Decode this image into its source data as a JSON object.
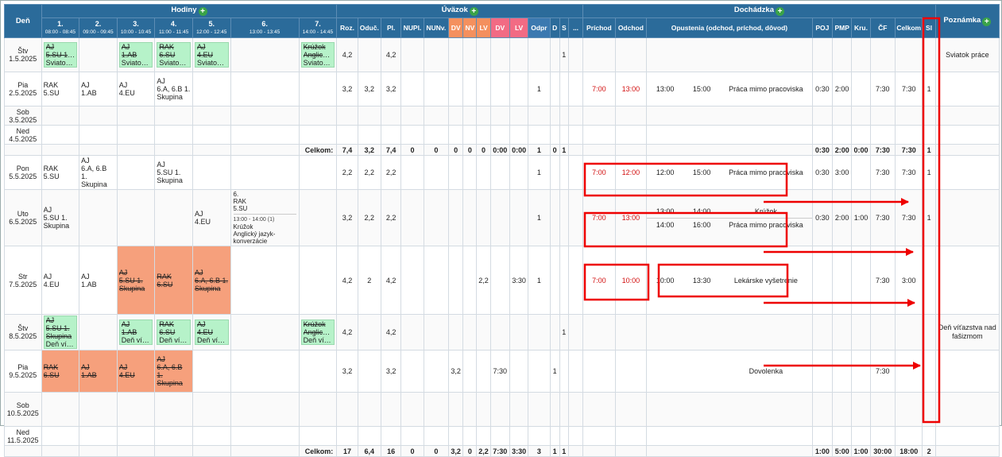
{
  "head": {
    "den": "Deň",
    "hodiny": "Hodiny",
    "uvazok": "Úväzok",
    "dochadzka": "Dochádzka",
    "poznamka": "Poznámka",
    "plus": "+",
    "periods": [
      [
        "1.",
        "08:00 - 08:45"
      ],
      [
        "2.",
        "09:00 - 09:45"
      ],
      [
        "3.",
        "10:00 - 10:45"
      ],
      [
        "4.",
        "11:00 - 11:45"
      ],
      [
        "5.",
        "12:00 - 12:45"
      ],
      [
        "6.",
        "13:00 - 13:45"
      ],
      [
        "7.",
        "14:00 - 14:45"
      ]
    ],
    "cols": [
      "Roz.",
      "Oduč.",
      "Pl.",
      "NUPl.",
      "NUNv.",
      "DV",
      "NV",
      "LV",
      "DV",
      "LV",
      "Odpr",
      "D",
      "S",
      "...",
      "Príchod",
      "Odchod",
      "Opustenia (odchod, príchod, dôvod)",
      "POJ",
      "PMP",
      "Kru.",
      "ČF",
      "Celkom",
      "Sl"
    ]
  },
  "rows": [
    {
      "day": "Štv",
      "date": "1.5.2025",
      "les": [
        "AJ|5.SU 1. Skupina|Sviatok práce",
        "",
        "AJ|1.AB|Sviatok práce",
        "RAK|6.SU|Sviatok práce",
        "AJ|4.EU|Sviatok práce",
        "",
        "Krúžok|Anglický jazyk-konverzácie|Sviatok práce"
      ],
      "v": [
        "4,2",
        "",
        "4,2",
        "",
        "",
        "",
        "",
        "",
        "",
        "",
        "",
        "",
        "1",
        ""
      ],
      "prich": "",
      "odch": "",
      "ab": [],
      "poj": "",
      "pmp": "",
      "kru": "",
      "cf": "",
      "cel": "",
      "sl": "",
      "note": "Sviatok práce"
    },
    {
      "day": "Pia",
      "date": "2.5.2025",
      "les": [
        "RAK|5.SU",
        "AJ|1.AB",
        "AJ|4.EU",
        "AJ|6.A, 6.B 1.|Skupina",
        "",
        "",
        ""
      ],
      "v": [
        "3,2",
        "3,2",
        "3,2",
        "",
        "",
        "",
        "",
        "",
        "",
        "",
        "1",
        "",
        "",
        ""
      ],
      "prich": "7:00",
      "odch": "13:00",
      "ab": [
        [
          "13:00",
          "15:00",
          "Práca mimo pracoviska"
        ]
      ],
      "poj": "0:30",
      "pmp": "2:00",
      "kru": "",
      "cf": "7:30",
      "cel": "7:30",
      "sl": "1",
      "note": ""
    },
    {
      "day": "Sob",
      "date": "3.5.2025",
      "les": [
        "",
        "",
        "",
        "",
        "",
        "",
        ""
      ],
      "v": [
        "",
        "",
        "",
        "",
        "",
        "",
        "",
        "",
        "",
        "",
        "",
        "",
        "",
        ""
      ],
      "prich": "",
      "odch": "",
      "ab": [],
      "poj": "",
      "pmp": "",
      "kru": "",
      "cf": "",
      "cel": "",
      "sl": "",
      "note": ""
    },
    {
      "day": "Ned",
      "date": "4.5.2025",
      "les": [
        "",
        "",
        "",
        "",
        "",
        "",
        ""
      ],
      "v": [
        "",
        "",
        "",
        "",
        "",
        "",
        "",
        "",
        "",
        "",
        "",
        "",
        "",
        ""
      ],
      "prich": "",
      "odch": "",
      "ab": [],
      "poj": "",
      "pmp": "",
      "kru": "",
      "cf": "",
      "cel": "",
      "sl": "",
      "note": ""
    },
    {
      "day": "Pon",
      "date": "5.5.2025",
      "les": [
        "RAK|5.SU",
        "AJ|6.A, 6.B|1.|Skupina",
        "",
        "AJ|5.SU 1.|Skupina",
        "",
        "",
        ""
      ],
      "v": [
        "2,2",
        "2,2",
        "2,2",
        "",
        "",
        "",
        "",
        "",
        "",
        "",
        "1",
        "",
        "",
        ""
      ],
      "prich": "7:00",
      "odch": "12:00",
      "ab": [
        [
          "12:00",
          "15:00",
          "Práca mimo pracoviska"
        ]
      ],
      "poj": "0:30",
      "pmp": "3:00",
      "kru": "",
      "cf": "7:30",
      "cel": "7:30",
      "sl": "1",
      "note": ""
    },
    {
      "day": "Uto",
      "date": "6.5.2025",
      "les": [
        "AJ|5.SU 1.|Skupina",
        "",
        "",
        "",
        "AJ|4.EU",
        "",
        ""
      ],
      "v": [
        "3,2",
        "2,2",
        "2,2",
        "",
        "",
        "",
        "",
        "",
        "",
        "",
        "1",
        "",
        "",
        ""
      ],
      "prich": "7:00",
      "odch": "13:00",
      "ab": [
        [
          "13:00",
          "14:00",
          "Krúžok"
        ],
        [
          "14:00",
          "16:00",
          "Práca mimo pracoviska"
        ]
      ],
      "poj": "0:30",
      "pmp": "2:00",
      "kru": "1:00",
      "cf": "7:30",
      "cel": "7:30",
      "sl": "1",
      "note": ""
    },
    {
      "day": "Str",
      "date": "7.5.2025",
      "les": [
        "AJ|4.EU",
        "AJ|1.AB",
        "AJ|5.SU 1.|Skupina",
        "RAK|6.SU",
        "AJ|6.A, 6.B 1.|Skupina",
        "",
        ""
      ],
      "v": [
        "4,2",
        "2",
        "4,2",
        "",
        "",
        "",
        "",
        "2,2",
        "",
        "3:30",
        "1",
        "",
        "",
        ""
      ],
      "prich": "7:00",
      "odch": "10:00",
      "ab": [
        [
          "10:00",
          "13:30",
          "Lekárske vyšetrenie"
        ]
      ],
      "poj": "",
      "pmp": "",
      "kru": "",
      "cf": "7:30",
      "cel": "3:00",
      "sl": "",
      "note": ""
    },
    {
      "day": "Štv",
      "date": "8.5.2025",
      "les": [
        "AJ|5.SU 1.|Skupina|Deň víťazstva nad fašizmom",
        "",
        "AJ|1.AB|Deň víťazstva nad fašizmom",
        "RAK|6.SU|Deň víťazstva nad fašizmom",
        "AJ|4.EU|Deň víťazstva nad fašizmom",
        "",
        "Krúžok|Anglický jazyk-konverzácie|Deň víťazstva nad fašizmom"
      ],
      "v": [
        "4,2",
        "",
        "4,2",
        "",
        "",
        "",
        "",
        "",
        "",
        "",
        "",
        "",
        "1",
        ""
      ],
      "prich": "",
      "odch": "",
      "ab": [],
      "poj": "",
      "pmp": "",
      "kru": "",
      "cf": "",
      "cel": "",
      "sl": "",
      "note": "Deň víťazstva nad fašizmom"
    },
    {
      "day": "Pia",
      "date": "9.5.2025",
      "les": [
        "RAK|6.SU",
        "AJ|1.AB",
        "AJ|4.EU",
        "AJ|6.A, 6.B|1.|Skupina",
        "",
        "",
        ""
      ],
      "v": [
        "3,2",
        "",
        "3,2",
        "",
        "",
        "3,2",
        "",
        "",
        "7:30",
        "",
        "",
        "1",
        "",
        ""
      ],
      "prich": "",
      "odch": "",
      "ab": [
        [
          "",
          "",
          "Dovolenka"
        ]
      ],
      "poj": "",
      "pmp": "",
      "kru": "",
      "cf": "7:30",
      "cel": "",
      "sl": "",
      "note": ""
    },
    {
      "day": "Sob",
      "date": "10.5.2025",
      "les": [
        "",
        "",
        "",
        "",
        "",
        "",
        ""
      ],
      "v": [
        "",
        "",
        "",
        "",
        "",
        "",
        "",
        "",
        "",
        "",
        "",
        "",
        "",
        ""
      ],
      "prich": "",
      "odch": "",
      "ab": [],
      "poj": "",
      "pmp": "",
      "kru": "",
      "cf": "",
      "cel": "",
      "sl": "",
      "note": ""
    },
    {
      "day": "Ned",
      "date": "11.5.2025",
      "les": [
        "",
        "",
        "",
        "",
        "",
        "",
        ""
      ],
      "v": [
        "",
        "",
        "",
        "",
        "",
        "",
        "",
        "",
        "",
        "",
        "",
        "",
        "",
        ""
      ],
      "prich": "",
      "odch": "",
      "ab": [],
      "poj": "",
      "pmp": "",
      "kru": "",
      "cf": "",
      "cel": "",
      "sl": "",
      "note": ""
    }
  ],
  "lesson6": {
    "text": "6.\nRAK\n5.SU",
    "time": "13:00 - 14:00 (1)",
    "name": "Krúžok\nAnglický jazyk-\nkonverzácie"
  },
  "totals": [
    {
      "label": "Celkom:",
      "v": [
        "7,4",
        "3,2",
        "7,4",
        "0",
        "0",
        "0",
        "0",
        "0",
        "0:00",
        "0:00",
        "1",
        "0",
        "1",
        ""
      ],
      "poj": "0:30",
      "pmp": "2:00",
      "kru": "0:00",
      "cf": "7:30",
      "cel": "7:30",
      "sl": "1"
    },
    {
      "label": "Celkom:",
      "v": [
        "17",
        "6,4",
        "16",
        "0",
        "0",
        "3,2",
        "0",
        "2,2",
        "7:30",
        "3:30",
        "3",
        "1",
        "1",
        ""
      ],
      "poj": "1:00",
      "pmp": "5:00",
      "kru": "1:00",
      "cf": "30:00",
      "cel": "18:00",
      "sl": "2"
    }
  ]
}
